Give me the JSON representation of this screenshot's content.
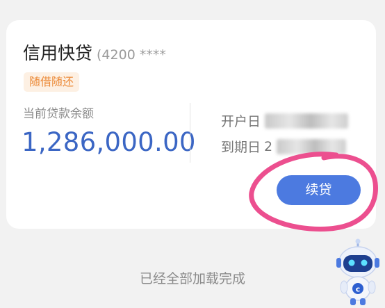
{
  "card": {
    "title": "信用快贷",
    "card_number": "(4200 ****",
    "tag": "随借随还",
    "balance_label": "当前贷款余额",
    "balance_value": "1,286,000.00",
    "open_date_label": "开户日",
    "due_date_label": "到期日",
    "due_date_partial": "2",
    "renew_button": "续贷"
  },
  "footer": {
    "text": "已经全部加载完成"
  },
  "colors": {
    "accent": "#4c7ae0",
    "balance": "#3b66c4",
    "tag_text": "#ec8b3a",
    "tag_bg": "#fdf0e3",
    "annotation_circle": "#ec4f8f"
  },
  "icons": {
    "assistant": "robot-assistant-icon"
  }
}
